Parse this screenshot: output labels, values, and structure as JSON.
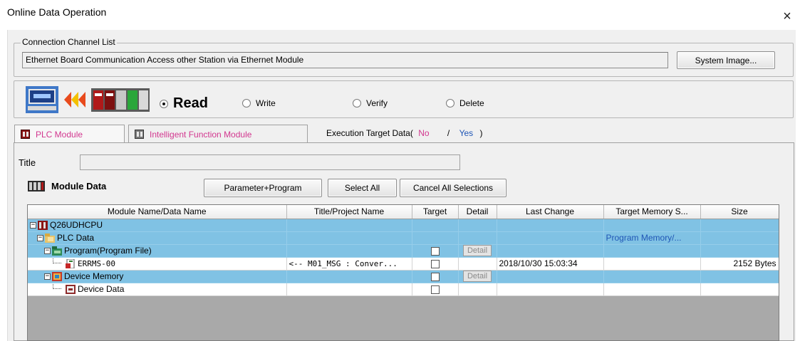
{
  "window": {
    "title": "Online Data Operation",
    "close_glyph": "×"
  },
  "connection": {
    "legend": "Connection Channel List",
    "value": "Ethernet Board Communication  Access other Station via Ethernet Module",
    "system_image_label": "System Image..."
  },
  "operation": {
    "selected": "Read",
    "options": [
      "Read",
      "Write",
      "Verify",
      "Delete"
    ]
  },
  "tabs": [
    {
      "label": "PLC Module",
      "active": true,
      "icon": "plc-module-icon"
    },
    {
      "label": "Intelligent Function Module",
      "active": false,
      "icon": "intelligent-module-icon"
    }
  ],
  "execution_target": {
    "label": "Execution Target Data(",
    "no": "No",
    "sep": "/",
    "yes": "Yes",
    "close": ")"
  },
  "title_field": {
    "label": "Title",
    "value": ""
  },
  "module_data": {
    "label": "Module Data",
    "buttons": {
      "param_program": "Parameter+Program",
      "select_all": "Select All",
      "cancel_all": "Cancel All Selections"
    }
  },
  "table": {
    "headers": [
      "Module Name/Data Name",
      "Title/Project Name",
      "Target",
      "Detail",
      "Last Change",
      "Target Memory S...",
      "Size"
    ],
    "rows": [
      {
        "name": "Q26UDHCPU",
        "indent": 0,
        "expander": "−",
        "icon": "cpu-icon",
        "title": "",
        "target": false,
        "detail": "",
        "last_change": "",
        "memory": "",
        "size": "",
        "highlight": true
      },
      {
        "name": "PLC Data",
        "indent": 1,
        "expander": "−",
        "icon": "plc-data-folder-icon",
        "title": "",
        "target": false,
        "detail": "",
        "last_change": "",
        "memory": "Program Memory/...",
        "size": "",
        "highlight": true
      },
      {
        "name": "Program(Program File)",
        "indent": 2,
        "expander": "−",
        "icon": "program-folder-icon",
        "title": "",
        "target": "checkbox",
        "detail": "Detail",
        "last_change": "",
        "memory": "",
        "size": "",
        "highlight": true
      },
      {
        "name": "ERRMS-00",
        "indent": 3,
        "expander": "",
        "icon": "program-file-icon",
        "title": "<-- M01_MSG : Conver...",
        "target": "checkbox",
        "detail": "",
        "last_change": "2018/10/30 15:03:34",
        "memory": "",
        "size": "2152 Bytes",
        "highlight": false
      },
      {
        "name": "Device Memory",
        "indent": 2,
        "expander": "−",
        "icon": "device-memory-icon",
        "title": "",
        "target": "checkbox",
        "detail": "Detail",
        "last_change": "",
        "memory": "",
        "size": "",
        "highlight": true
      },
      {
        "name": "Device Data",
        "indent": 3,
        "expander": "",
        "icon": "device-data-icon",
        "title": "",
        "target": "checkbox",
        "detail": "",
        "last_change": "",
        "memory": "",
        "size": "",
        "highlight": false
      }
    ]
  },
  "colors": {
    "selection": "#80c2e4",
    "pink_text": "#d2378f",
    "blue_text": "#1f56b6",
    "grid_bg": "#a9a9a9"
  }
}
